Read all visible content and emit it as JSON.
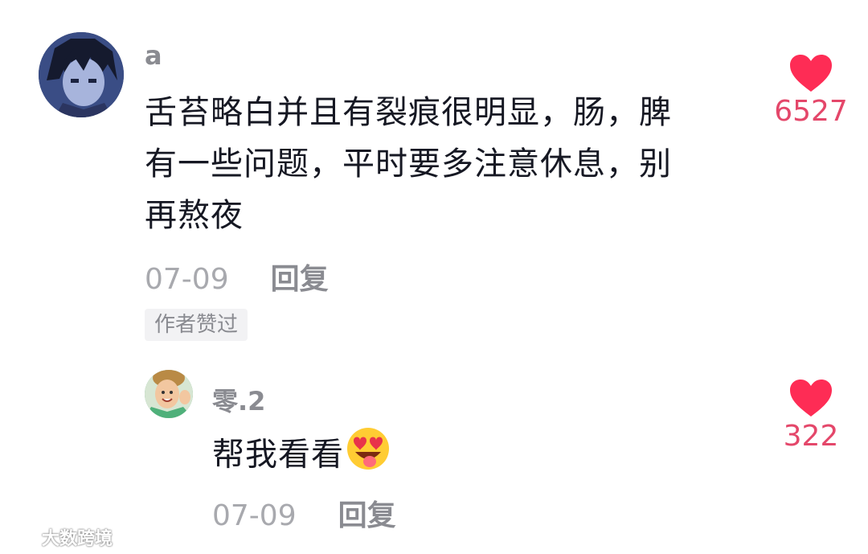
{
  "comments": [
    {
      "username": "a",
      "text_lines": [
        "舌苔略白并且有裂痕很明显，肠，脾",
        "有一些问题，平时要多注意休息，别",
        "再熬夜"
      ],
      "date": "07-09",
      "reply_label": "回复",
      "badge": "作者赞过",
      "likes": "6527"
    },
    {
      "username": "零.2",
      "text": "帮我看看",
      "emoji": "star-struck-tongue-emoji",
      "date": "07-09",
      "reply_label": "回复",
      "likes": "322"
    }
  ],
  "watermark": "大数跨境",
  "colors": {
    "like_heart": "#fe2c55",
    "like_count": "#e4476a",
    "meta_gray": "#a8a9ae",
    "badge_bg": "#f2f2f4"
  }
}
